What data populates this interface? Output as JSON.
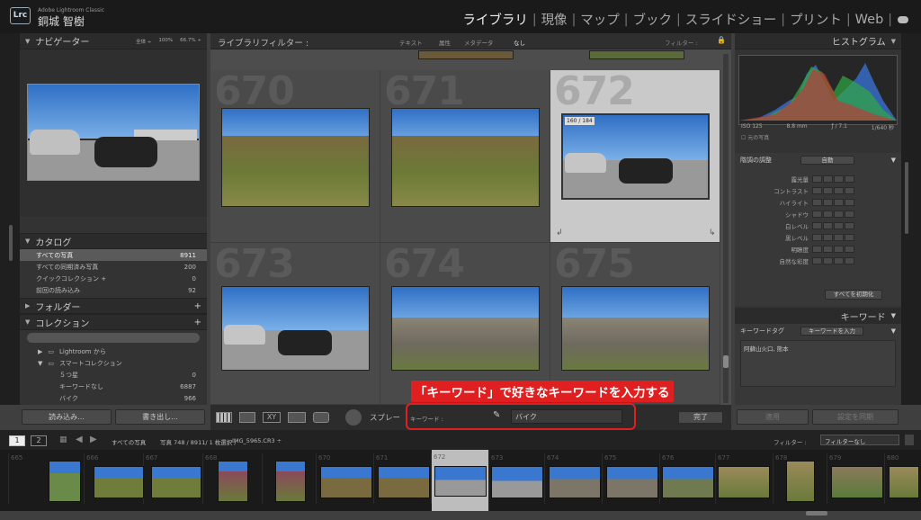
{
  "app": {
    "logo": "Lrc",
    "brand_line1": "Adobe Lightroom Classic",
    "user": "銅城 智樹"
  },
  "modules": [
    "ライブラリ",
    "現像",
    "マップ",
    "ブック",
    "スライドショー",
    "プリント",
    "Web"
  ],
  "navigator": {
    "title": "ナビゲーター",
    "zoom": [
      "全体 ÷",
      "100%",
      "66.7% ÷"
    ]
  },
  "catalog": {
    "title": "カタログ",
    "items": [
      {
        "label": "すべての写真",
        "count": "8911"
      },
      {
        "label": "すべての同期済み写真",
        "count": "200"
      },
      {
        "label": "クイックコレクション +",
        "count": "0"
      },
      {
        "label": "前回の読み込み",
        "count": "92"
      }
    ]
  },
  "folders": {
    "title": "フォルダー"
  },
  "collections": {
    "title": "コレクション",
    "items": [
      {
        "label": "Lightroom から",
        "count": ""
      },
      {
        "label": "スマートコレクション",
        "count": ""
      },
      {
        "label": "５つ星",
        "count": "0"
      },
      {
        "label": "キーワードなし",
        "count": "6887"
      },
      {
        "label": "バイク",
        "count": "966"
      }
    ]
  },
  "left_buttons": {
    "import": "読み込み...",
    "export": "書き出し..."
  },
  "filterbar": {
    "title": "ライブラリフィルター :",
    "options": [
      "テキスト",
      "属性",
      "メタデータ",
      "なし"
    ],
    "filter_label": "フィルター :"
  },
  "grid": {
    "numbers": [
      "670",
      "671",
      "672",
      "673",
      "674",
      "675"
    ],
    "badge": "160 / 184"
  },
  "histogram": {
    "title": "ヒストグラム",
    "iso": "ISO 125",
    "focal": "8.8 mm",
    "aperture": "ƒ / 7.1",
    "shutter": "1/640 秒",
    "original": "元の写真"
  },
  "quick_develop": {
    "preset_label": "階調の調整",
    "auto": "自動",
    "rows": [
      "露光量",
      "コントラスト",
      "ハイライト",
      "シャドウ",
      "白レベル",
      "黒レベル",
      "明瞭度",
      "自然な彩度"
    ],
    "reset": "すべてを初期化"
  },
  "keywords": {
    "title": "キーワード",
    "tag_label": "キーワードタグ",
    "tag_mode": "キーワードを入力",
    "tags": "阿蘇山火口, 熊本",
    "apply_btn": "適用",
    "sync_btn": "設定を同期"
  },
  "toolbar": {
    "spray": "スプレー",
    "kw_label": "キーワード :",
    "kw_value": "バイク",
    "done": "完了"
  },
  "callout": "「キーワード」で好きなキーワードを入力する",
  "secondary": {
    "page1": "1",
    "page2": "2",
    "source": "すべての写真",
    "count_info": "写真 748 / 8911/ 1 枚選択 /",
    "filename": "IMG_5965.CR3 ÷",
    "filter_label": "フィルター :",
    "filter_value": "フィルターなし"
  },
  "filmstrip": {
    "numbers": [
      "",
      "665",
      "666",
      "667",
      "668",
      "",
      "670",
      "671",
      "672",
      "673",
      "674",
      "675",
      "676",
      "677",
      "678",
      "679",
      "680"
    ]
  },
  "colors": {
    "accent": "#e02020",
    "selected_cell": "#c9c9c9"
  }
}
